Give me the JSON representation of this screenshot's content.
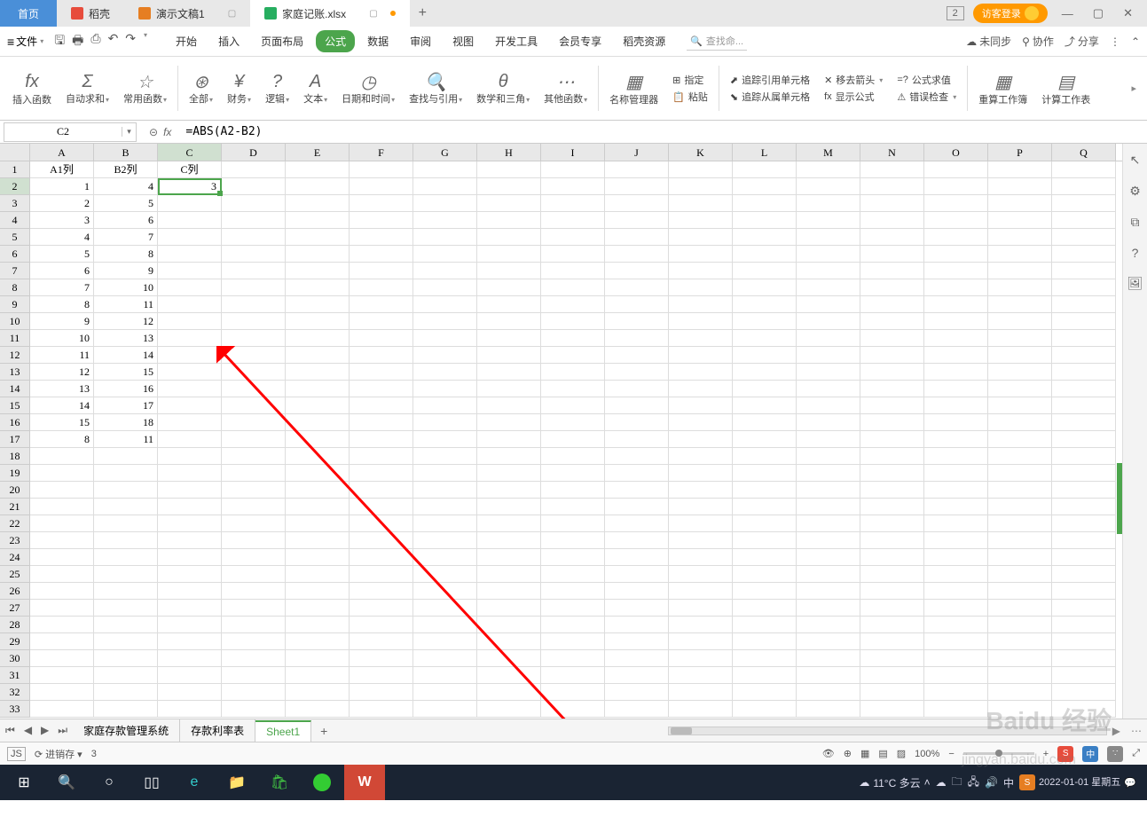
{
  "tabs": {
    "home": "首页",
    "t1": "稻壳",
    "t2": "演示文稿1",
    "t3": "家庭记账.xlsx",
    "plus": "+"
  },
  "topRight": {
    "badge": "2",
    "login": "访客登录"
  },
  "menu": {
    "file": "文件",
    "items": [
      "开始",
      "插入",
      "页面布局",
      "公式",
      "数据",
      "审阅",
      "视图",
      "开发工具",
      "会员专享",
      "稻壳资源"
    ],
    "searchPlaceholder": "查找命...",
    "unsync": "未同步",
    "coop": "协作",
    "share": "分享"
  },
  "ribbon": {
    "r1": "插入函数",
    "r2": "自动求和",
    "r3": "常用函数",
    "r4": "全部",
    "r5": "财务",
    "r6": "逻辑",
    "r7": "文本",
    "r8": "日期和时间",
    "r9": "查找与引用",
    "r10": "数学和三角",
    "r11": "其他函数",
    "r12": "名称管理器",
    "r13a": "指定",
    "r13b": "粘贴",
    "r14a": "追踪引用单元格",
    "r14b": "追踪从属单元格",
    "r15a": "移去箭头",
    "r15b": "显示公式",
    "r16a": "公式求值",
    "r16b": "错误检查",
    "r17": "重算工作簿",
    "r18": "计算工作表"
  },
  "nameBox": "C2",
  "formula": "=ABS(A2-B2)",
  "columns": [
    "A",
    "B",
    "C",
    "D",
    "E",
    "F",
    "G",
    "H",
    "I",
    "J",
    "K",
    "L",
    "M",
    "N",
    "O",
    "P",
    "Q"
  ],
  "headers": {
    "A": "A1列",
    "B": "B2列",
    "C": "C列"
  },
  "data": [
    {
      "r": 2,
      "A": "1",
      "B": "4",
      "C": "3"
    },
    {
      "r": 3,
      "A": "2",
      "B": "5"
    },
    {
      "r": 4,
      "A": "3",
      "B": "6"
    },
    {
      "r": 5,
      "A": "4",
      "B": "7"
    },
    {
      "r": 6,
      "A": "5",
      "B": "8"
    },
    {
      "r": 7,
      "A": "6",
      "B": "9"
    },
    {
      "r": 8,
      "A": "7",
      "B": "10"
    },
    {
      "r": 9,
      "A": "8",
      "B": "11"
    },
    {
      "r": 10,
      "A": "9",
      "B": "12"
    },
    {
      "r": 11,
      "A": "10",
      "B": "13"
    },
    {
      "r": 12,
      "A": "11",
      "B": "14"
    },
    {
      "r": 13,
      "A": "12",
      "B": "15"
    },
    {
      "r": 14,
      "A": "13",
      "B": "16"
    },
    {
      "r": 15,
      "A": "14",
      "B": "17"
    },
    {
      "r": 16,
      "A": "15",
      "B": "18"
    },
    {
      "r": 17,
      "A": "8",
      "B": "11"
    }
  ],
  "rowCount": 33,
  "sheetTabs": [
    "家庭存款管理系统",
    "存款利率表",
    "Sheet1"
  ],
  "status": {
    "left1": "进销存",
    "left2": "3",
    "zoom": "100%"
  },
  "taskbar": {
    "weather": "11°C 多云",
    "time": "2022-01-01 星期五",
    "ime": "中"
  },
  "watermark1": "Baidu 经验",
  "watermark2": "jingyan.baidu.com"
}
